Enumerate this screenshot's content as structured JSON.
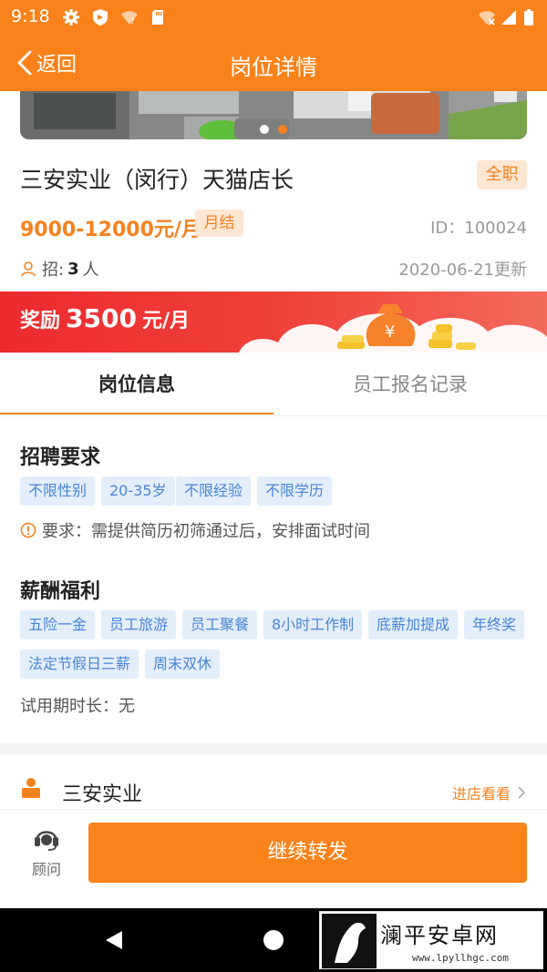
{
  "status_bar": {
    "time": "9:18"
  },
  "nav": {
    "back_label": "返回",
    "title": "岗位详情"
  },
  "job": {
    "title": "三安实业（闵行）天猫店长",
    "type_badge": "全职",
    "salary": "9000-12000元/月",
    "pay_badge": "月结",
    "id_text": "ID：100024",
    "recruit_label": "招:",
    "recruit_count": "3",
    "recruit_unit": "人",
    "updated": "2020-06-21更新"
  },
  "reward": {
    "label": "奖励",
    "amount": "3500",
    "unit": "元/月"
  },
  "tabs": [
    {
      "label": "岗位信息",
      "active": true
    },
    {
      "label": "员工报名记录",
      "active": false
    }
  ],
  "requirements": {
    "title": "招聘要求",
    "tags": [
      "不限性别",
      "20-35岁",
      "不限经验",
      "不限学历"
    ],
    "note": "要求：需提供简历初筛通过后，安排面试时间"
  },
  "benefits": {
    "title": "薪酬福利",
    "tags": [
      "五险一金",
      "员工旅游",
      "员工聚餐",
      "8小时工作制",
      "底薪加提成",
      "年终奖",
      "法定节假日三薪",
      "周末双休"
    ],
    "probation": "试用期时长：无"
  },
  "company": {
    "name": "三安实业",
    "link_label": "进店看看"
  },
  "bottom": {
    "advisor_label": "顾问",
    "share_label": "继续转发"
  },
  "watermark": {
    "title": "澜平安卓网",
    "url": "www.lpyllhgc.com"
  },
  "colors": {
    "brand_orange": "#f9821a",
    "tag_bg": "#e3eefb",
    "tag_text": "#4a84d6",
    "reward_red": "#ec2b2f"
  }
}
